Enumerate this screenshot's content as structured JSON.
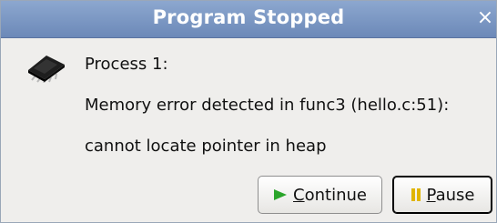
{
  "window": {
    "title": "Program Stopped",
    "close_glyph": "×"
  },
  "content": {
    "icon": "chip-icon",
    "line1": "Process 1:",
    "line2": "Memory error detected in func3 (hello.c:51):",
    "line3": "cannot locate pointer in heap"
  },
  "buttons": {
    "continue_mnemonic": "C",
    "continue_rest": "ontinue",
    "pause_mnemonic": "P",
    "pause_rest": "ause"
  },
  "colors": {
    "titlebar": "#7b97c4",
    "continue_icon": "#2aa52a",
    "pause_icon": "#e0b500"
  }
}
